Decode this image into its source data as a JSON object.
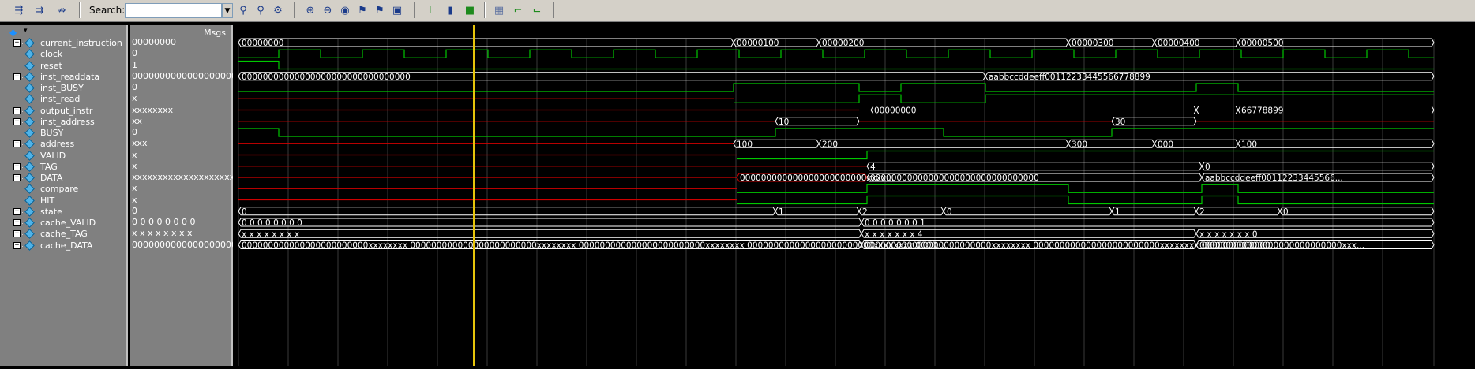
{
  "toolbar": {
    "search_label": "Search:",
    "search_value": "",
    "icons": [
      "step-in-icon",
      "step-out-icon",
      "step-over-icon",
      "find-prev-icon",
      "find-next-icon",
      "find-options-icon",
      "zoom-in-icon",
      "zoom-out-icon",
      "zoom-fit-icon",
      "zoom-cursor-icon",
      "zoom-mark-icon",
      "zoom-region-icon",
      "cursor-mode-icon",
      "bookmark-icon",
      "fill-icon",
      "grid-icon",
      "edge-rise-icon",
      "edge-fall-icon"
    ]
  },
  "header": {
    "msgs_label": "Msgs"
  },
  "signals": [
    {
      "name": "current_instruction",
      "value": "00000000",
      "expandable": true
    },
    {
      "name": "clock",
      "value": "0",
      "expandable": false
    },
    {
      "name": "reset",
      "value": "1",
      "expandable": false
    },
    {
      "name": "inst_readdata",
      "value": "00000000000000000000...",
      "expandable": true
    },
    {
      "name": "inst_BUSY",
      "value": "0",
      "expandable": false
    },
    {
      "name": "inst_read",
      "value": "x",
      "expandable": false
    },
    {
      "name": "output_instr",
      "value": "xxxxxxxx",
      "expandable": true
    },
    {
      "name": "inst_address",
      "value": "xx",
      "expandable": true
    },
    {
      "name": "BUSY",
      "value": "0",
      "expandable": false
    },
    {
      "name": "address",
      "value": "xxx",
      "expandable": true
    },
    {
      "name": "VALID",
      "value": "x",
      "expandable": false
    },
    {
      "name": "TAG",
      "value": "x",
      "expandable": true
    },
    {
      "name": "DATA",
      "value": "xxxxxxxxxxxxxxxxxxxxx...",
      "expandable": true
    },
    {
      "name": "compare",
      "value": "x",
      "expandable": false
    },
    {
      "name": "HIT",
      "value": "x",
      "expandable": false
    },
    {
      "name": "state",
      "value": "0",
      "expandable": true
    },
    {
      "name": "cache_VALID",
      "value": "0 0 0 0 0 0 0 0",
      "expandable": true
    },
    {
      "name": "cache_TAG",
      "value": "x x x x x x x x",
      "expandable": true
    },
    {
      "name": "cache_DATA",
      "value": "00000000000000000000...",
      "expandable": true
    }
  ],
  "wave_labels": {
    "current_instruction": [
      "00000000",
      "00000100",
      "00000200",
      "00000300",
      "00000400",
      "00000500"
    ],
    "inst_readdata": [
      "00000000000000000000000000000000",
      "aabbccddeeff00112233445566778899"
    ],
    "output_instr": [
      "00000000",
      "66778899"
    ],
    "inst_address": [
      "10",
      "30"
    ],
    "address": [
      "100",
      "200",
      "300",
      "000",
      "100"
    ],
    "TAG": [
      "4",
      "0"
    ],
    "DATA": [
      "000000000000000000000000xxxx...",
      "00000000000000000000000000000000",
      "aabbccddeeff00112233445566..."
    ],
    "state": [
      "0",
      "1",
      "2",
      "0",
      "1",
      "2",
      "0"
    ],
    "cache_VALID": [
      "0 0 0 0 0 0 0 0",
      "0 0 0 0 0 0 0 1"
    ],
    "cache_TAG": [
      "x x x x x x x x",
      "x x x x x x x 4",
      "x x x x x x x 0"
    ],
    "cache_DATA": [
      "000000000000000000000000xxxxxxxx 000000000000000000000000xxxxxxxx 000000000000000000000000xxxxxxxx 000000000000000000000000xxxxxxxx 0000...",
      "000000000000000000000000xxxxxxxx 000000000000000000000000xxxxxxxx 0000000000000...",
      "000000000000000000000000000xxx..."
    ]
  },
  "colors": {
    "wave_green": "#00c800",
    "wave_red": "#d00000",
    "cursor": "#e6c40a",
    "bus_white": "#ffffff"
  }
}
